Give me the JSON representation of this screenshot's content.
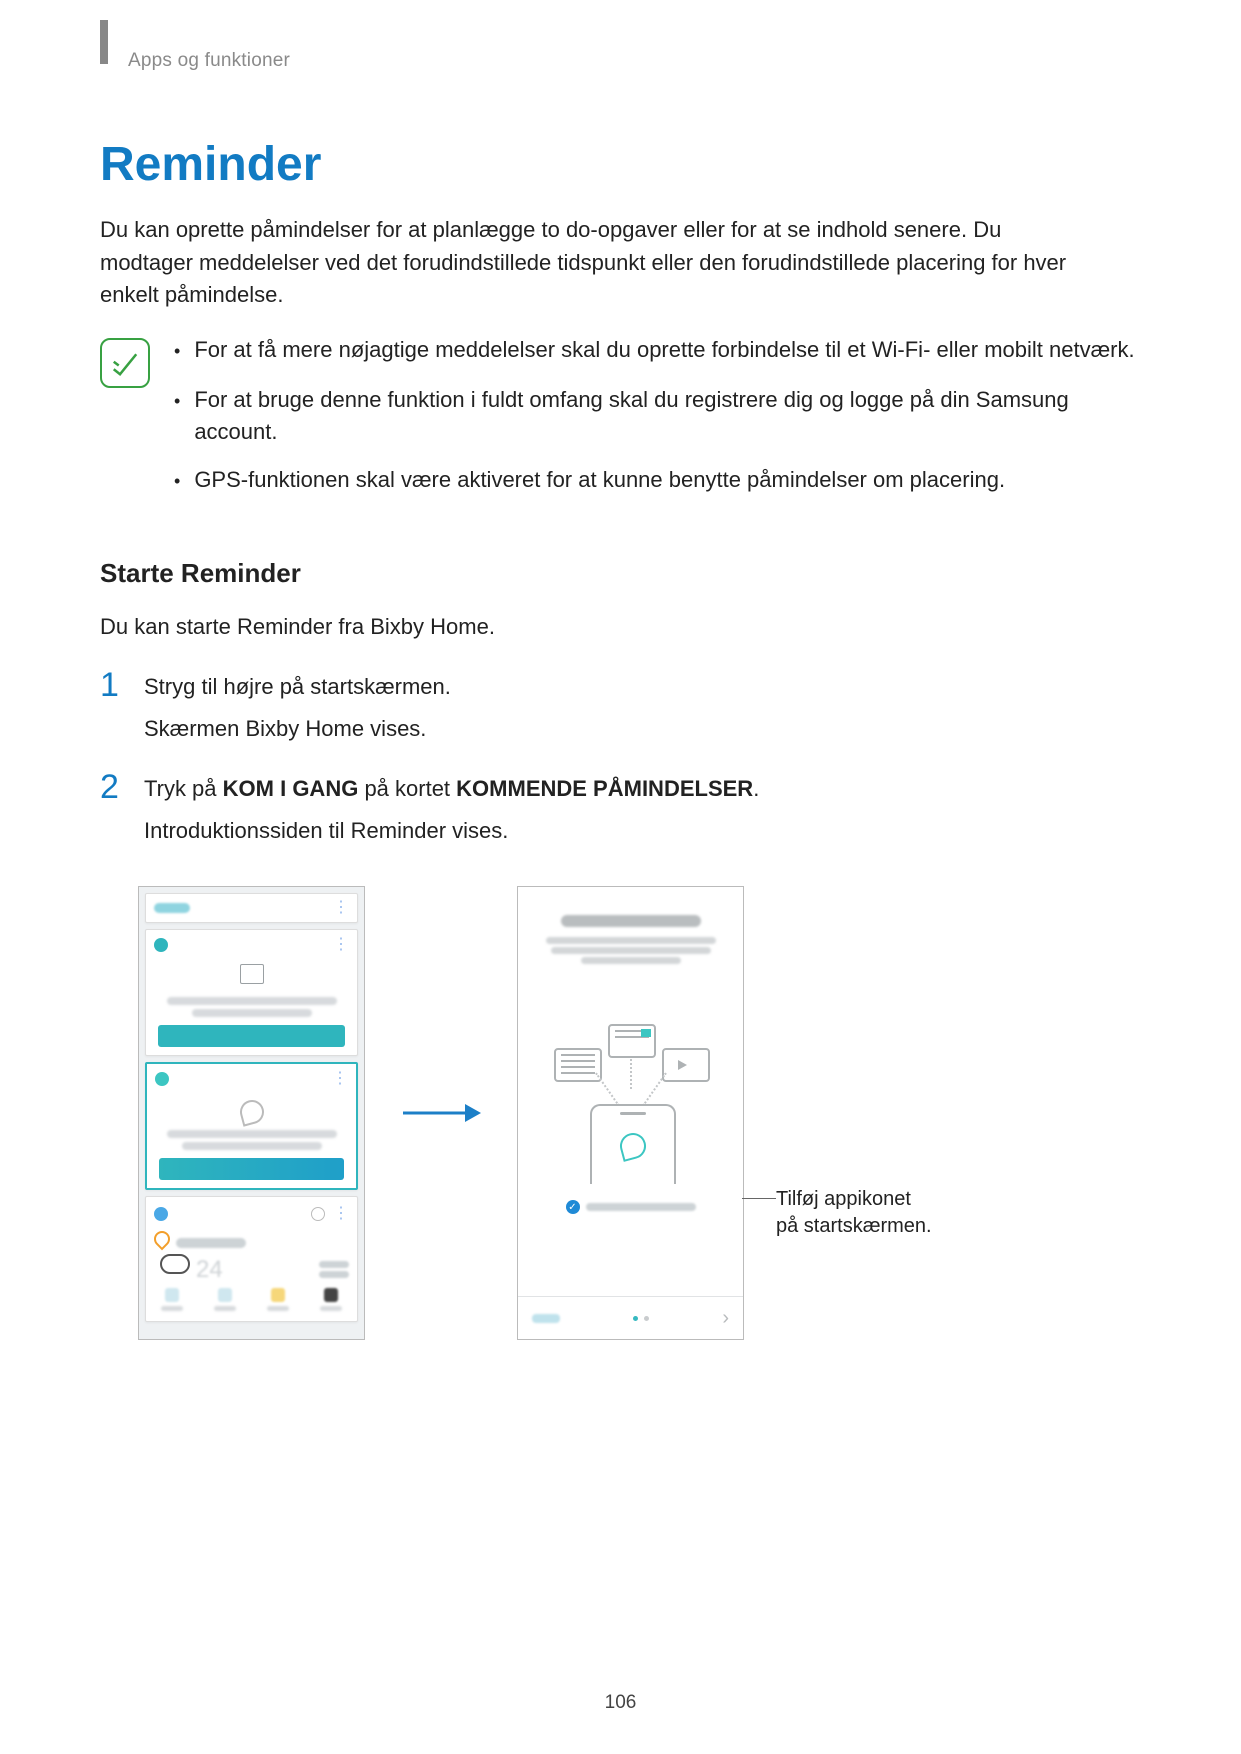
{
  "header": {
    "breadcrumb": "Apps og funktioner"
  },
  "title": "Reminder",
  "intro": "Du kan oprette påmindelser for at planlægge to do-opgaver eller for at se indhold senere. Du modtager meddelelser ved det forudindstillede tidspunkt eller den forudindstillede placering for hver enkelt påmindelse.",
  "notes": {
    "items": [
      "For at få mere nøjagtige meddelelser skal du oprette forbindelse til et Wi-Fi- eller mobilt netværk.",
      "For at bruge denne funktion i fuldt omfang skal du registrere dig og logge på din Samsung account.",
      "GPS-funktionen skal være aktiveret for at kunne benytte påmindelser om placering."
    ]
  },
  "section_heading": "Starte Reminder",
  "section_intro": "Du kan starte Reminder fra Bixby Home.",
  "steps": [
    {
      "num": "1",
      "text": "Stryg til højre på startskærmen.",
      "sub": "Skærmen Bixby Home vises."
    },
    {
      "num": "2",
      "text_parts": [
        "Tryk på ",
        "KOM I GANG",
        " på kortet ",
        "KOMMENDE PÅMINDELSER",
        "."
      ],
      "sub": "Introduktionssiden til Reminder vises."
    }
  ],
  "callout": {
    "line1": "Tilføj appikonet",
    "line2": "på startskærmen."
  },
  "page_number": "106"
}
